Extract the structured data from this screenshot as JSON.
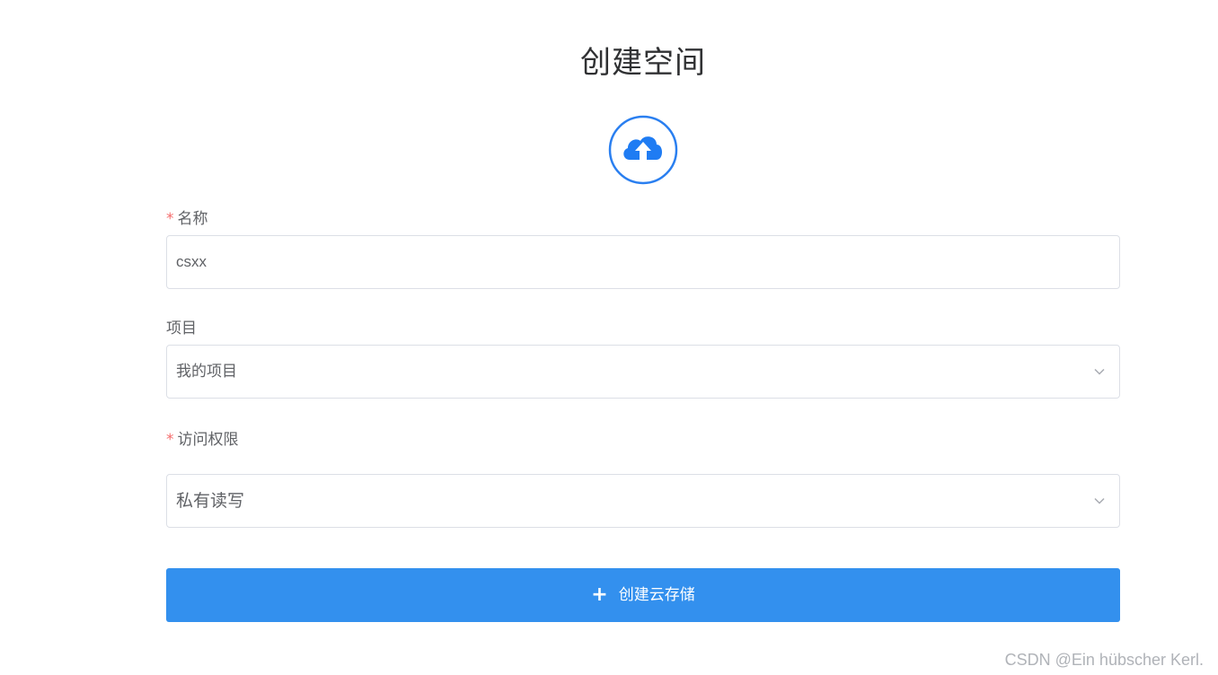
{
  "page": {
    "title": "创建空间"
  },
  "form": {
    "name": {
      "label": "名称",
      "required_mark": "*",
      "value": "csxx"
    },
    "project": {
      "label": "项目",
      "selected": "我的项目"
    },
    "access": {
      "label": "访问权限",
      "required_mark": "*",
      "selected": "私有读写"
    },
    "submit": {
      "icon": "+",
      "label": "创建云存储"
    }
  },
  "watermark": "CSDN @Ein hübscher Kerl.",
  "colors": {
    "accent": "#3390ee",
    "icon_blue": "#2a7ff0",
    "required": "#f56c6c",
    "border": "#dcdfe6"
  }
}
